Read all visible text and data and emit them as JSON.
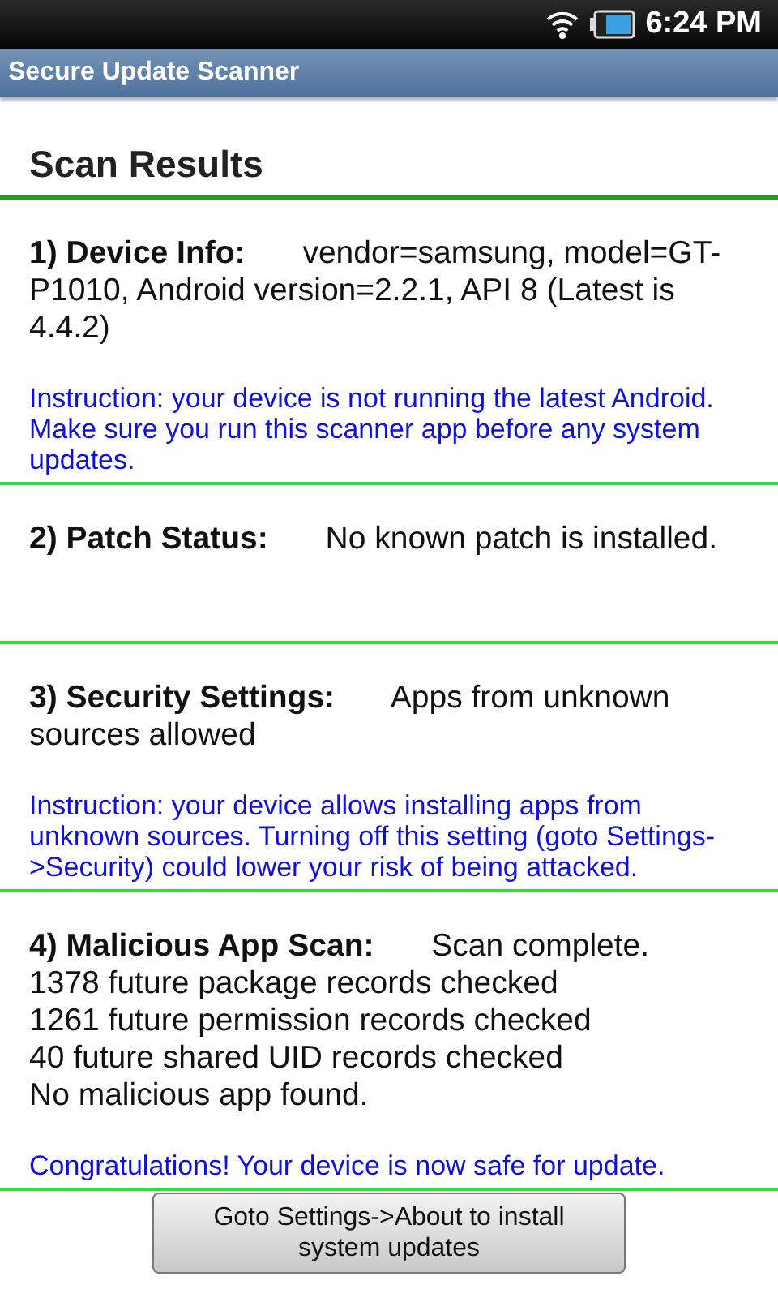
{
  "status_bar": {
    "time": "6:24 PM"
  },
  "title_bar": {
    "title": "Secure Update Scanner"
  },
  "heading": "Scan Results",
  "sections": [
    {
      "summary": "**1) Device Info:** vendor=samsung, model=GT-P1010, Android version=2.2.1, API 8 (Latest is 4.4.2)",
      "instruction": "Instruction: your device is not running the latest Android. Make sure you run this scanner app before any system updates."
    },
    {
      "summary": "**2) Patch Status:** No known patch is installed."
    },
    {
      "summary": "**3) Security Settings:** Apps from unknown sources allowed",
      "instruction": "Instruction: your device allows installing apps from unknown sources. Turning off this setting (goto Settings->Security) could lower your risk of being attacked."
    },
    {
      "summary": "**4) Malicious App Scan:** Scan complete.",
      "details": [
        "1378 future package records checked",
        "1261 future permission records checked",
        "40 future shared UID records checked",
        "No malicious app found."
      ],
      "instruction": "Congratulations! Your device is now safe for update."
    }
  ],
  "button": {
    "label": "Goto Settings->About to install system updates"
  }
}
